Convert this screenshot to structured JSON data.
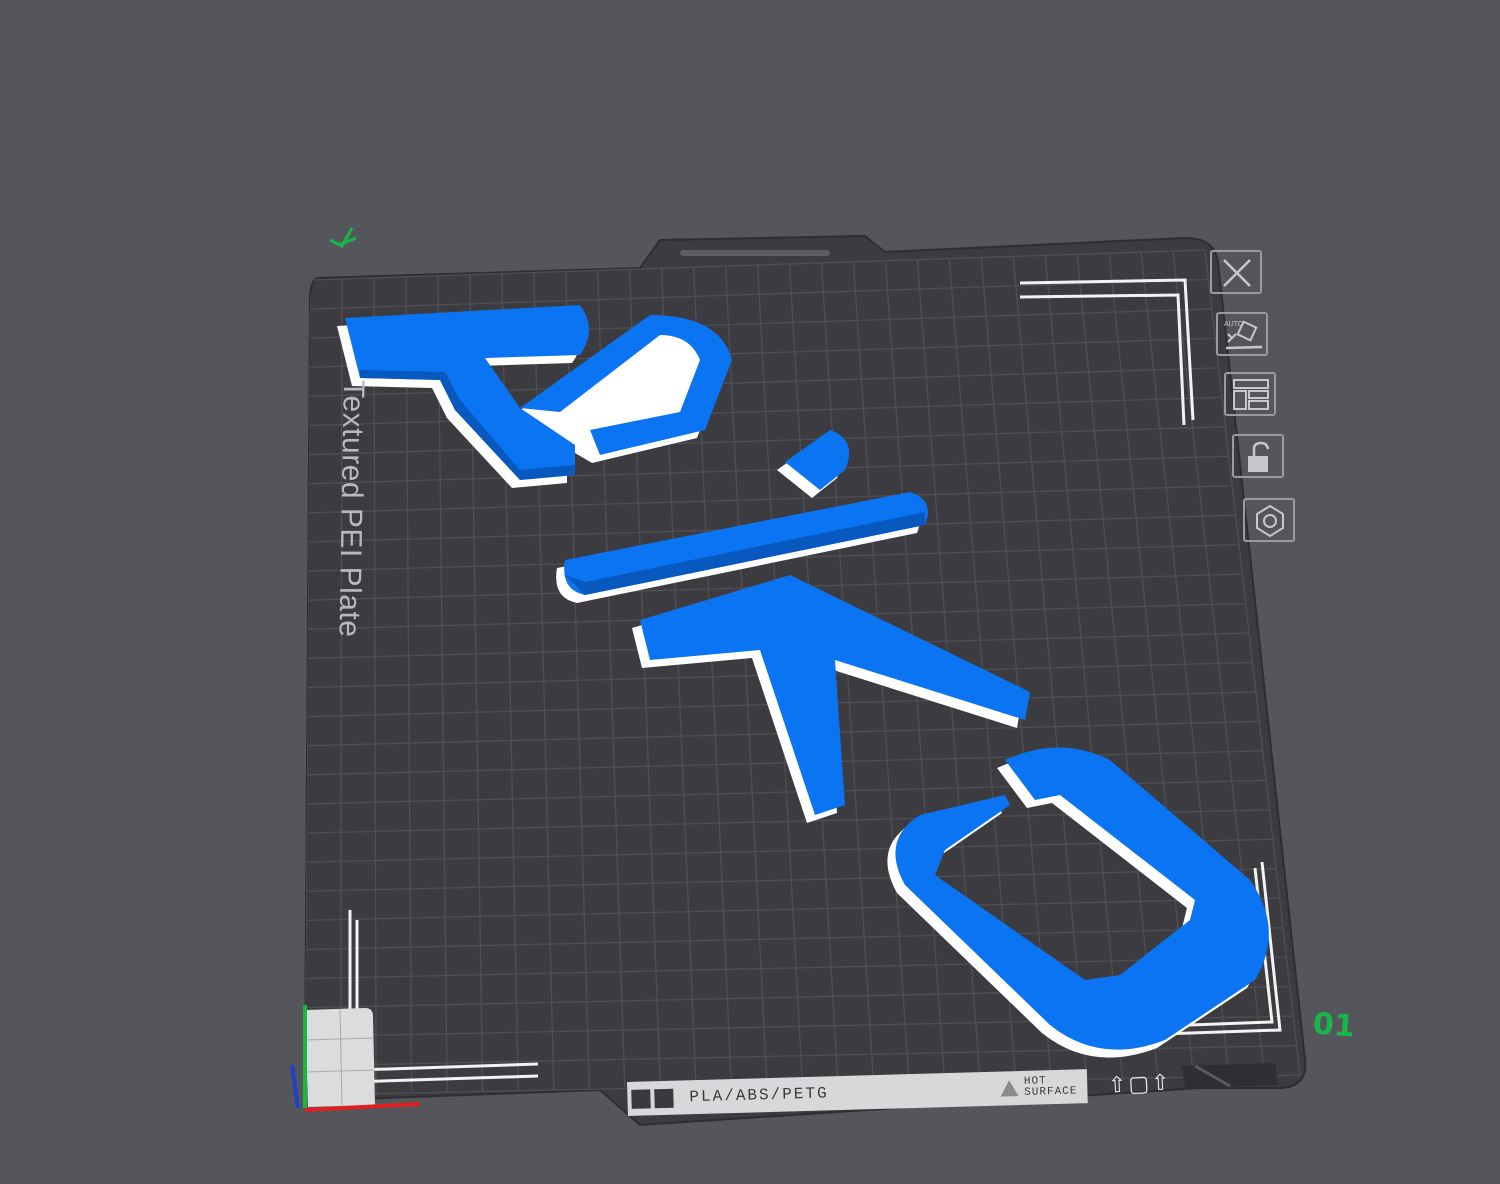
{
  "plate": {
    "label": "Textured PEI Plate",
    "number": "01",
    "material": "PLA/ABS/PETG",
    "hot_surface_line1": "HOT",
    "hot_surface_line2": "SURFACE"
  },
  "model": {
    "text": "AiKO",
    "color": "#0a74f2"
  },
  "toolbar": {
    "icons": [
      "close-icon",
      "auto-orient-icon",
      "arrange-icon",
      "lock-icon",
      "settings-icon"
    ],
    "auto_label": "AUTO"
  },
  "colors": {
    "background": "#55555c",
    "plate": "#3b3b40",
    "grid": "#4d4d52",
    "model": "#0a74f2",
    "number": "#19b64a"
  }
}
